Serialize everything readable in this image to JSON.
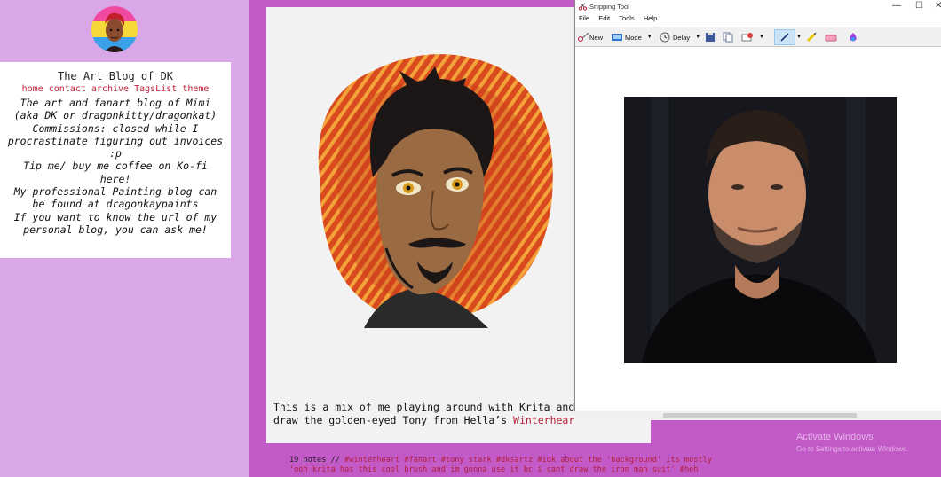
{
  "sidebar": {
    "title": "The Art Blog of DK",
    "nav": [
      "home",
      "contact",
      "archive",
      "TagsList",
      "theme"
    ],
    "description": [
      "The art and fanart blog of Mimi",
      "(aka DK or dragonkitty/dragonkat)",
      "Commissions: closed while I",
      "procrastinate figuring out invoices",
      ":p",
      "Tip me/ buy me coffee on Ko-fi",
      "here!",
      "My professional Painting blog can",
      "be found at dragonkaypaints",
      "If you want to know the url of my",
      "personal blog, you can ask me!"
    ]
  },
  "post": {
    "caption_line1": "This is a mix of me playing around with Krita and",
    "caption_line2_prefix": "draw the golden-eyed Tony from Hella’s ",
    "caption_line2_link": "Winterheart",
    "notes_count": "19 notes //",
    "tags_line1": "#winterheart #fanart #tony stark #dksartz #idk about the 'background' its mostly",
    "tags_line2": "'ooh krita has this cool brush and im gonna use it bc i cant draw the iron man suit' #heh"
  },
  "snipping_tool": {
    "title": "Snipping Tool",
    "menu": [
      "File",
      "Edit",
      "Tools",
      "Help"
    ],
    "toolbar": {
      "new": "New",
      "mode": "Mode",
      "delay": "Delay"
    }
  },
  "watermark": {
    "line1": "Activate Windows",
    "line2": "Go to Settings to activate Windows."
  },
  "colors": {
    "link": "#c0203a",
    "right_bg": "#c25ac8",
    "left_bg": "#d9a7e8"
  }
}
